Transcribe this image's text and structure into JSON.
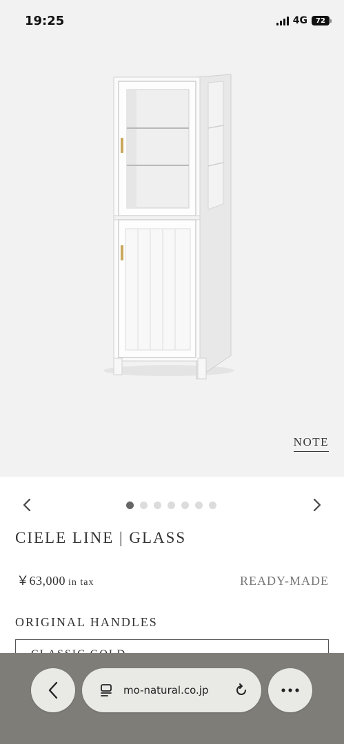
{
  "status_bar": {
    "time": "19:25",
    "network": "4G",
    "battery": "72",
    "icons": [
      "signal-icon",
      "battery-icon"
    ]
  },
  "hero": {
    "note_label": "NOTE",
    "background_color": "#f2f2f2"
  },
  "carousel": {
    "dot_count": 7,
    "active_index": 0,
    "icons": [
      "chevron-left-icon",
      "chevron-right-icon"
    ]
  },
  "product": {
    "title": "CIELE LINE | GLASS",
    "price": "￥63,000",
    "price_note": "in tax",
    "type": "READY-MADE",
    "handles_heading": "ORIGINAL HANDLES",
    "handle_selected": "CLASSIC GOLD"
  },
  "browser": {
    "url": "mo-natural.co.jp",
    "icons": [
      "back-chevron-icon",
      "reader-icon",
      "reload-icon",
      "more-icon"
    ],
    "bar_color": "#7e7d78"
  }
}
